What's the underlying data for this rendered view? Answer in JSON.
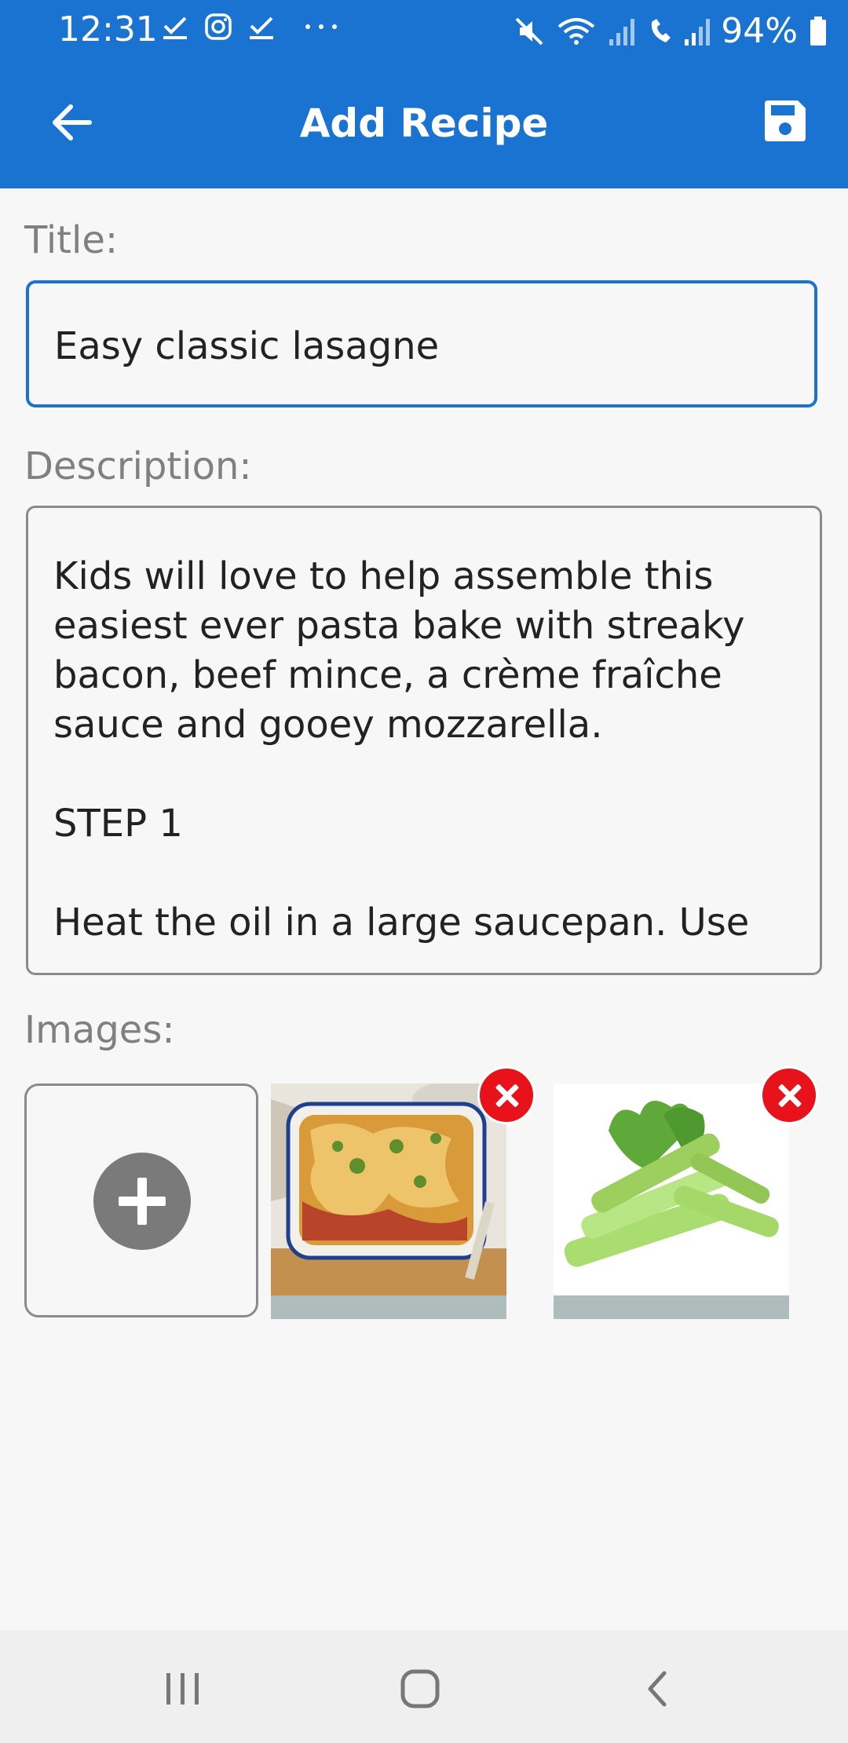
{
  "status_bar": {
    "time": "12:31",
    "battery": "94%",
    "left_icons": [
      "check-icon",
      "instagram-icon",
      "check-icon",
      "more-dots-icon"
    ],
    "right_icons": [
      "mute-icon",
      "wifi-icon",
      "signal-icon",
      "call-signal-icon",
      "battery-icon"
    ]
  },
  "app_bar": {
    "title": "Add Recipe",
    "back_icon": "arrow-back-icon",
    "save_icon": "save-icon",
    "color": "#1a73d1"
  },
  "form": {
    "title_label": "Title:",
    "title_value": "Easy classic lasagne",
    "description_label": "Description:",
    "description_value": "Kids will love to help assemble this easiest ever pasta bake with streaky bacon, beef mince, a crème fraîche sauce and gooey mozzarella.\n\nSTEP 1\n\nHeat the oil in a large saucepan. Use",
    "images_label": "Images:"
  },
  "images": [
    {
      "name": "lasagne-photo"
    },
    {
      "name": "celery-photo"
    }
  ],
  "nav_bar": {
    "icons": [
      "recent-apps-icon",
      "home-icon",
      "back-icon"
    ]
  }
}
